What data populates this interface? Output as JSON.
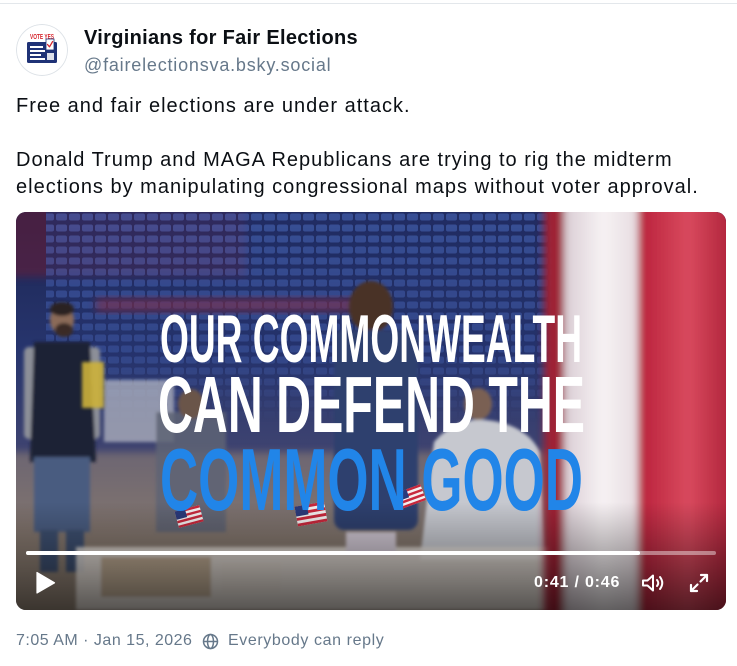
{
  "theme": {
    "text_primary": "#0b0f14",
    "text_secondary": "#66788a",
    "divider": "#e3e7eb"
  },
  "author": {
    "display_name": "Virginians for Fair Elections",
    "handle": "@fairelectionsva.bsky.social",
    "avatar": {
      "logo_text": "VOTE YES",
      "logo_text_color": "#d6262e",
      "logo_box_color": "#1f3276"
    }
  },
  "post": {
    "paragraphs": [
      "Free and fair elections are under attack.",
      "Donald Trump and MAGA Republicans are trying to rig the midterm elections by manipulating congressional maps without voter approval."
    ]
  },
  "video": {
    "overlay_text": [
      "OUR COMMONWEALTH",
      "CAN DEFEND THE",
      "COMMON GOOD"
    ],
    "overlay_colors": [
      "#ffffff",
      "#ffffff",
      "#2185e8"
    ],
    "controls": {
      "play_icon": "play-icon",
      "played_fraction": 0.89,
      "time_display": "0:41 / 0:46",
      "volume_icon": "volume-icon",
      "fullscreen_icon": "fullscreen-icon"
    }
  },
  "footer": {
    "timestamp": "7:05 AM · Jan 15, 2026",
    "reply_setting_icon": "globe-icon",
    "reply_setting": "Everybody can reply"
  }
}
